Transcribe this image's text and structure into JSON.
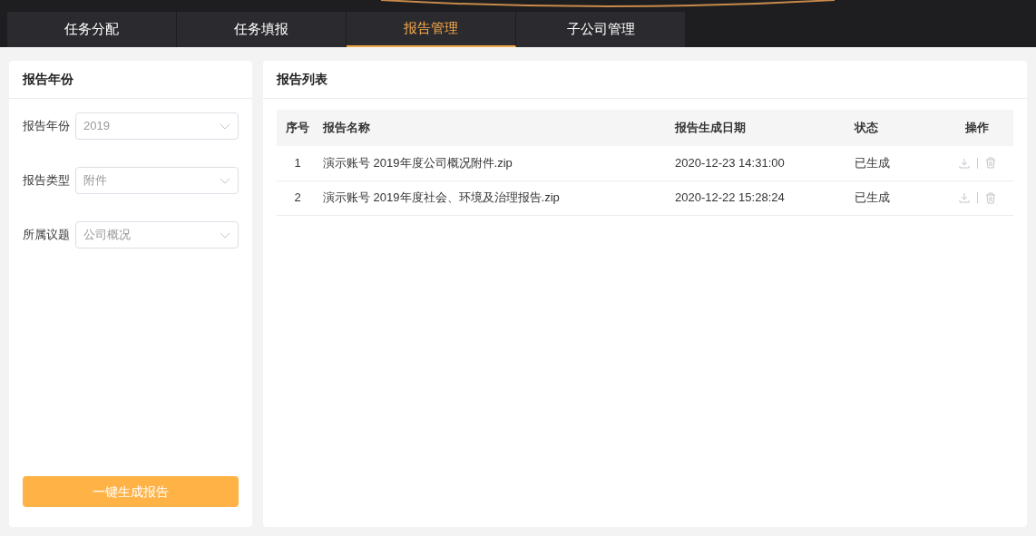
{
  "tabs": [
    {
      "label": "任务分配",
      "selected": false
    },
    {
      "label": "任务填报",
      "selected": false
    },
    {
      "label": "报告管理",
      "selected": true
    },
    {
      "label": "子公司管理",
      "selected": false
    }
  ],
  "filter_panel": {
    "title": "报告年份",
    "fields": [
      {
        "label": "报告年份",
        "value": "2019"
      },
      {
        "label": "报告类型",
        "value": "附件"
      },
      {
        "label": "所属议题",
        "value": "公司概况"
      }
    ],
    "generate_button": "一键生成报告"
  },
  "report_list": {
    "title": "报告列表",
    "columns": [
      "序号",
      "报告名称",
      "报告生成日期",
      "状态",
      "操作"
    ],
    "rows": [
      {
        "index": "1",
        "name": "演示账号 2019年度公司概况附件.zip",
        "date": "2020-12-23 14:31:00",
        "status": "已生成"
      },
      {
        "index": "2",
        "name": "演示账号 2019年度社会、环境及治理报告.zip",
        "date": "2020-12-22 15:28:24",
        "status": "已生成"
      }
    ]
  }
}
